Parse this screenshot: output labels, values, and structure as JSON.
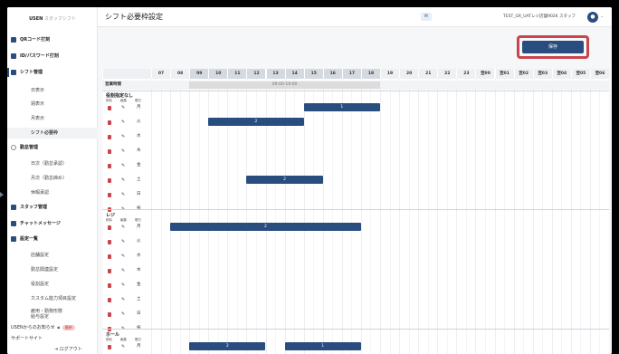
{
  "sidebar": {
    "logo_brand": "USEN",
    "logo_product": "スタッフシフト",
    "items": [
      {
        "label": "QRコード打刻",
        "icon": "qr-icon",
        "kind": "main"
      },
      {
        "label": "ID/パスワード打刻",
        "icon": "user-icon",
        "kind": "main"
      },
      {
        "label": "シフト管理",
        "icon": "calendar-icon",
        "kind": "main-active"
      },
      {
        "label": "日表示",
        "kind": "sub"
      },
      {
        "label": "週表示",
        "kind": "sub"
      },
      {
        "label": "月表示",
        "kind": "sub"
      },
      {
        "label": "シフト必要枠",
        "kind": "sub-active"
      },
      {
        "label": "勤怠管理",
        "icon": "clock-icon",
        "kind": "main-outline"
      },
      {
        "label": "日次（勤怠承認）",
        "kind": "sub"
      },
      {
        "label": "月次（勤怠締め）",
        "kind": "sub"
      },
      {
        "label": "休暇承認",
        "kind": "sub"
      },
      {
        "label": "スタッフ管理",
        "icon": "staff-icon",
        "kind": "main"
      },
      {
        "label": "チャットメッセージ",
        "icon": "chat-icon",
        "kind": "main"
      },
      {
        "label": "設定一覧",
        "icon": "gear-icon",
        "kind": "main"
      },
      {
        "label": "店舗設定",
        "kind": "sub"
      },
      {
        "label": "勤怠関連設定",
        "kind": "sub"
      },
      {
        "label": "役割設定",
        "kind": "sub"
      },
      {
        "label": "カスタム能力項目設定",
        "kind": "sub"
      },
      {
        "label": "雇用・勤務形態",
        "label2": "給与設定",
        "kind": "sub"
      }
    ],
    "notice_label": "USENからのお知らせ",
    "notice_badge": "最新",
    "support_label": "サポートサイト",
    "logout_label": "ログアウト"
  },
  "header": {
    "title": "シフト必要枠設定",
    "user_name": "TEST_GR_UATレジ店舗9026 スタッフ"
  },
  "toolbar": {
    "save_label": "保存"
  },
  "grid": {
    "hours": [
      "07",
      "08",
      "09",
      "10",
      "11",
      "12",
      "13",
      "14",
      "15",
      "16",
      "17",
      "18",
      "19",
      "20",
      "21",
      "22",
      "23",
      "翌00",
      "翌01",
      "翌02",
      "翌03",
      "翌04",
      "翌05",
      "翌06"
    ],
    "business_hours_label": "営業時間",
    "business_hours_value": "09:00-19:00",
    "business_start": "09:00",
    "business_end": "19:00",
    "col_headers": [
      "削除",
      "編集",
      "曜日"
    ],
    "groups": [
      {
        "name": "役割指定なし",
        "rows": [
          {
            "day": "月",
            "shifts": [
              {
                "start": "15:00",
                "end": "19:00",
                "count": "1"
              }
            ]
          },
          {
            "day": "火",
            "shifts": [
              {
                "start": "10:00",
                "end": "15:00",
                "count": "2"
              }
            ]
          },
          {
            "day": "水",
            "shifts": []
          },
          {
            "day": "木",
            "shifts": []
          },
          {
            "day": "金",
            "shifts": []
          },
          {
            "day": "土",
            "shifts": [
              {
                "start": "12:00",
                "end": "16:00",
                "count": "2"
              }
            ]
          },
          {
            "day": "日",
            "shifts": []
          },
          {
            "day": "祝",
            "shifts": []
          }
        ]
      },
      {
        "name": "レジ",
        "rows": [
          {
            "day": "月",
            "shifts": [
              {
                "start": "08:00",
                "end": "18:00",
                "count": "2"
              }
            ]
          },
          {
            "day": "火",
            "shifts": []
          },
          {
            "day": "水",
            "shifts": []
          },
          {
            "day": "木",
            "shifts": []
          },
          {
            "day": "金",
            "shifts": []
          },
          {
            "day": "土",
            "shifts": []
          },
          {
            "day": "日",
            "shifts": []
          },
          {
            "day": "祝",
            "shifts": []
          }
        ]
      },
      {
        "name": "ホール",
        "rows": [
          {
            "day": "月",
            "shifts": [
              {
                "start": "09:00",
                "end": "13:00",
                "count": "2"
              },
              {
                "start": "14:00",
                "end": "18:00",
                "count": "1"
              }
            ]
          }
        ]
      }
    ]
  }
}
